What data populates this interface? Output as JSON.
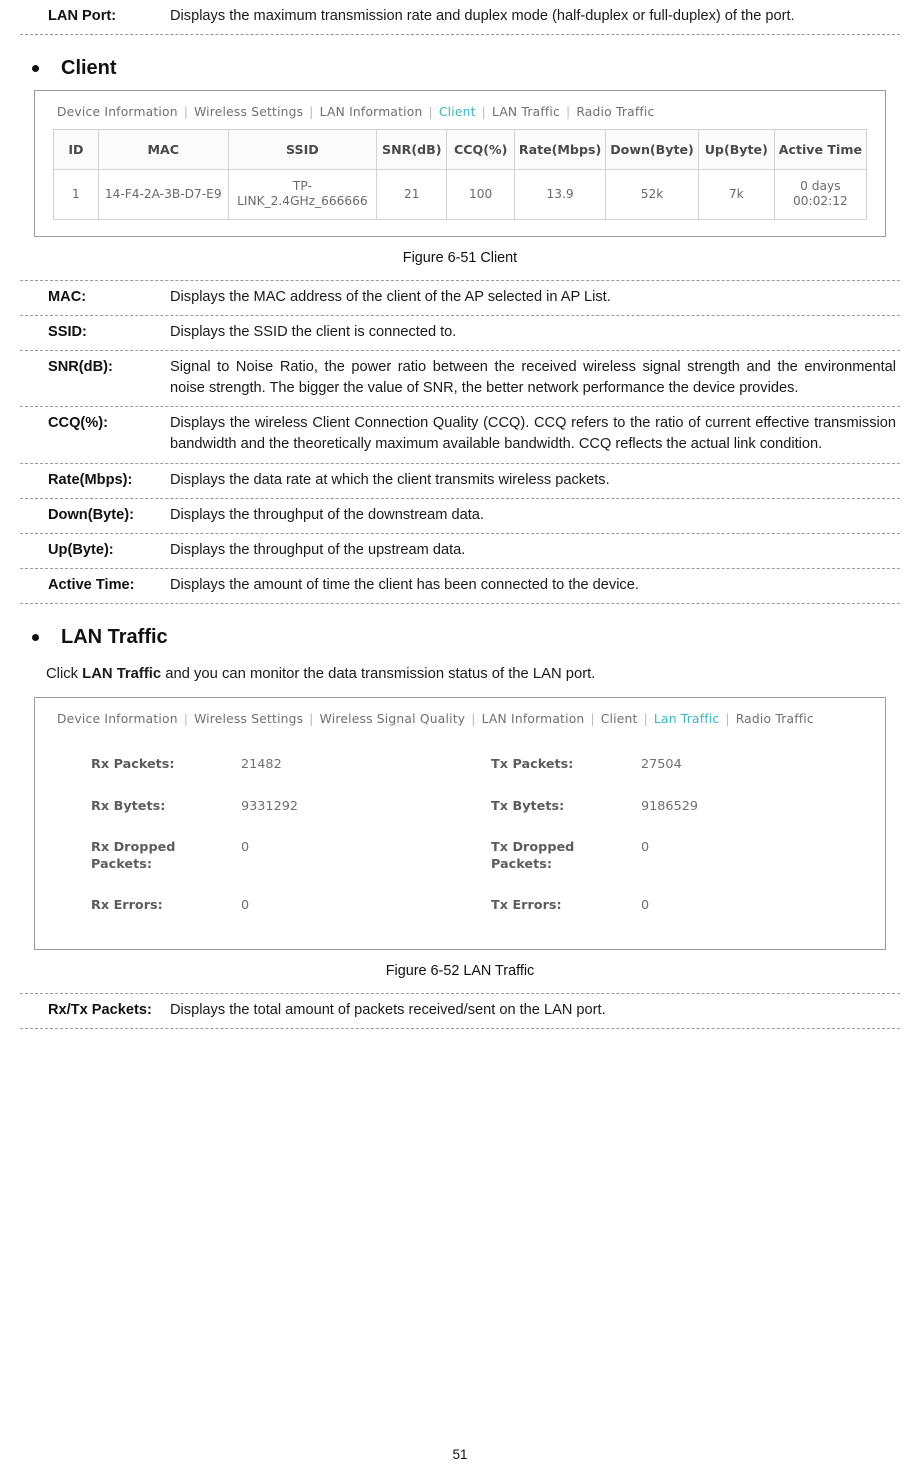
{
  "top_def": {
    "term": "LAN Port:",
    "desc": "Displays the maximum transmission rate and duplex mode (half-duplex or full-duplex) of the port."
  },
  "client_section": {
    "heading": "Client",
    "screenshot": {
      "tabs": [
        {
          "label": "Device Information",
          "active": false
        },
        {
          "label": "Wireless Settings",
          "active": false
        },
        {
          "label": "LAN Information",
          "active": false
        },
        {
          "label": "Client",
          "active": true
        },
        {
          "label": "LAN Traffic",
          "active": false
        },
        {
          "label": "Radio Traffic",
          "active": false
        }
      ],
      "table": {
        "headers": [
          "ID",
          "MAC",
          "SSID",
          "SNR(dB)",
          "CCQ(%)",
          "Rate(Mbps)",
          "Down(Byte)",
          "Up(Byte)",
          "Active Time"
        ],
        "rows": [
          [
            "1",
            "14-F4-2A-3B-D7-E9",
            "TP-LINK_2.4GHz_666666",
            "21",
            "100",
            "13.9",
            "52k",
            "7k",
            "0 days 00:02:12"
          ]
        ]
      }
    },
    "figure_caption": "Figure 6-51 Client",
    "definitions": [
      {
        "term": "MAC:",
        "desc": "Displays the MAC address of the client of the AP selected in AP List."
      },
      {
        "term": "SSID:",
        "desc": "Displays the SSID the client is connected to."
      },
      {
        "term": "SNR(dB):",
        "desc": "Signal to Noise Ratio, the power ratio between the received wireless signal strength and the environmental noise strength. The bigger the value of SNR, the better network performance the device provides."
      },
      {
        "term": "CCQ(%):",
        "desc": "Displays the wireless Client Connection Quality (CCQ). CCQ refers to the ratio of current effective transmission bandwidth and the theoretically maximum available bandwidth. CCQ reflects the actual link condition."
      },
      {
        "term": "Rate(Mbps):",
        "desc": "Displays the data rate at which the client transmits wireless packets."
      },
      {
        "term": "Down(Byte):",
        "desc": "Displays the throughput of the downstream data."
      },
      {
        "term": "Up(Byte):",
        "desc": "Displays the throughput of the upstream data."
      },
      {
        "term": "Active Time:",
        "desc": "Displays the amount of time the client has been connected to the device."
      }
    ]
  },
  "lan_traffic_section": {
    "heading": "LAN Traffic",
    "intro_pre": "Click ",
    "intro_bold": "LAN Traffic",
    "intro_post": " and you can monitor the data transmission status of the LAN port.",
    "screenshot": {
      "tabs": [
        {
          "label": "Device Information",
          "active": false
        },
        {
          "label": "Wireless Settings",
          "active": false
        },
        {
          "label": "Wireless Signal Quality",
          "active": false
        },
        {
          "label": "LAN Information",
          "active": false
        },
        {
          "label": "Client",
          "active": false
        },
        {
          "label": "Lan Traffic",
          "active": true
        },
        {
          "label": "Radio Traffic",
          "active": false
        }
      ],
      "stats": [
        {
          "label": "Rx Packets:",
          "value": "21482",
          "label2": "Tx Packets:",
          "value2": "27504"
        },
        {
          "label": "Rx Bytets:",
          "value": "9331292",
          "label2": "Tx Bytets:",
          "value2": "9186529"
        },
        {
          "label": "Rx Dropped\nPackets:",
          "value": "0",
          "label2": "Tx Dropped\nPackets:",
          "value2": "0"
        },
        {
          "label": "Rx Errors:",
          "value": "0",
          "label2": "Tx Errors:",
          "value2": "0"
        }
      ]
    },
    "figure_caption": "Figure 6-52 LAN Traffic",
    "definitions": [
      {
        "term": "Rx/Tx Packets:",
        "desc": "Displays the total amount of packets received/sent on the LAN port."
      }
    ]
  },
  "page_number": "51"
}
